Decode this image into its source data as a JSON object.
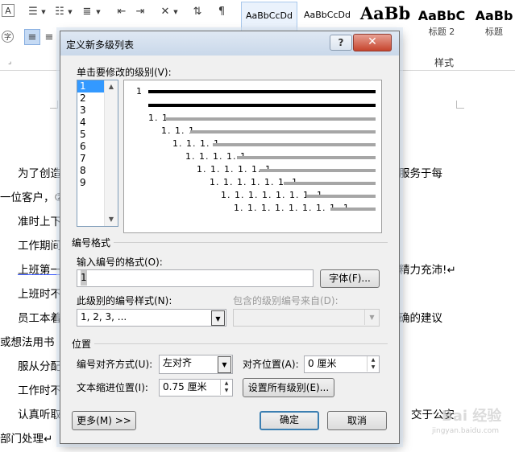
{
  "ribbon": {
    "styles": [
      {
        "sample": "AaBbCcDd",
        "name": ""
      },
      {
        "sample": "AaBbCcDd",
        "name": ""
      },
      {
        "sample": "AaBb",
        "name": ""
      },
      {
        "sample": "AaBbC",
        "name": "标题 2"
      },
      {
        "sample": "AaBb",
        "name": "标题"
      }
    ],
    "styles_group_label": "样式"
  },
  "document": {
    "lines": [
      "为了创造",
      "服务于每",
      "一位客户，②",
      "准时上下",
      "工作期间",
      "上班第一",
      "精力充沛!↵",
      "上班时不",
      "员工本着",
      "确的建议",
      "或想法用书",
      "服从分配",
      "工作时不",
      "认真听取",
      "交于公安",
      "部门处理↵"
    ]
  },
  "watermark": {
    "text": "Bai 经验",
    "url": "jingyan.baidu.com"
  },
  "dialog": {
    "title": "定义新多级列表",
    "help": "?",
    "close": "✕",
    "level_label": "单击要修改的级别(V):",
    "levels": [
      "1",
      "2",
      "3",
      "4",
      "5",
      "6",
      "7",
      "8",
      "9"
    ],
    "selected_level": "1",
    "preview_numbers": [
      "1",
      "1. 1",
      "1. 1. 1",
      "1. 1. 1. 1",
      "1. 1. 1. 1. 1",
      "1. 1. 1. 1. 1. 1",
      "1. 1. 1. 1. 1. 1. 1",
      "1. 1. 1. 1. 1. 1. 1. 1",
      "1. 1. 1. 1. 1. 1. 1. 1. 1"
    ],
    "number_format_group": "编号格式",
    "enter_format_label": "输入编号的格式(O):",
    "format_value": "1",
    "font_button": "字体(F)...",
    "number_style_label": "此级别的编号样式(N):",
    "number_style_value": "1, 2, 3, ...",
    "include_level_label": "包含的级别编号来自(D):",
    "include_level_value": "",
    "position_group": "位置",
    "alignment_label": "编号对齐方式(U):",
    "alignment_value": "左对齐",
    "align_at_label": "对齐位置(A):",
    "align_at_value": "0 厘米",
    "indent_label": "文本缩进位置(I):",
    "indent_value": "0.75 厘米",
    "set_all_button": "设置所有级别(E)...",
    "more_button": "更多(M) >>",
    "ok_button": "确定",
    "cancel_button": "取消"
  }
}
